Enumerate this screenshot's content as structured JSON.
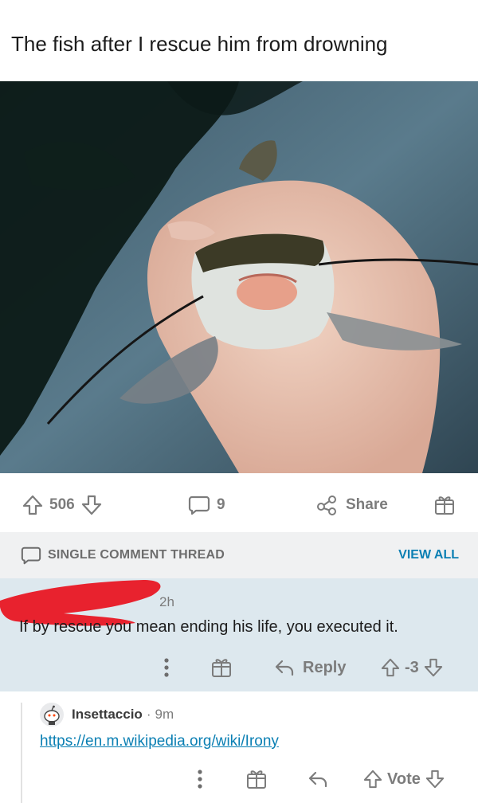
{
  "post": {
    "title": "The fish after I rescue him from drowning",
    "image_alt": "hand holding a catfish with its mouth open above dark water"
  },
  "actions": {
    "score": "506",
    "comments": "9",
    "share_label": "Share"
  },
  "thread_bar": {
    "label": "SINGLE COMMENT THREAD",
    "view_all": "VIEW ALL"
  },
  "comment": {
    "time": "2h",
    "body": "If by rescue you mean ending his life, you executed it.",
    "reply_label": "Reply",
    "score": "-3"
  },
  "reply": {
    "username": "Insettaccio",
    "separator": "·",
    "time": "9m",
    "link": "https://en.m.wikipedia.org/wiki/Irony",
    "vote_label": "Vote"
  },
  "colors": {
    "link": "#0a7fb3",
    "highlight_bg": "#dde8ee",
    "thread_bar_bg": "#f0f1f2",
    "redaction": "#e8222e",
    "muted": "#7c7c7c"
  },
  "icons": [
    "upvote-icon",
    "downvote-icon",
    "comment-icon",
    "share-icon",
    "award-icon",
    "more-icon",
    "reply-icon",
    "avatar-icon"
  ]
}
